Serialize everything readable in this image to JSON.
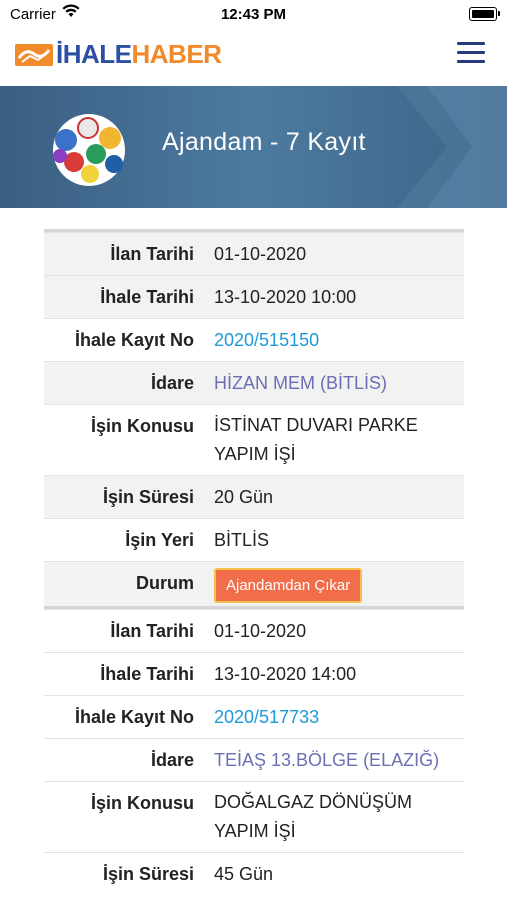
{
  "status": {
    "carrier": "Carrier",
    "time": "12:43 PM"
  },
  "brand": {
    "part1": "İHALE",
    "part2": "HABER"
  },
  "banner": {
    "title": "Ajandam - 7 Kayıt"
  },
  "labels": {
    "ilan_tarihi": "İlan Tarihi",
    "ihale_tarihi": "İhale Tarihi",
    "kayit_no": "İhale Kayıt No",
    "idare": "İdare",
    "isin_konusu": "İşin Konusu",
    "isin_suresi": "İşin Süresi",
    "isin_yeri": "İşin Yeri",
    "durum": "Durum"
  },
  "records": [
    {
      "ilan_tarihi": "01-10-2020",
      "ihale_tarihi": "13-10-2020 10:00",
      "kayit_no": "2020/515150",
      "idare": "HİZAN MEM (BİTLİS)",
      "isin_konusu_line1": "İSTİNAT DUVARI PARKE",
      "isin_konusu_line2": "YAPIM İŞİ",
      "isin_suresi": "20 Gün",
      "isin_yeri": "BİTLİS",
      "durum_button": "Ajandamdan Çıkar"
    },
    {
      "ilan_tarihi": "01-10-2020",
      "ihale_tarihi": "13-10-2020 14:00",
      "kayit_no": "2020/517733",
      "idare": "TEİAŞ 13.BÖLGE (ELAZIĞ)",
      "isin_konusu_line1": "DOĞALGAZ DÖNÜŞÜM",
      "isin_konusu_line2": "YAPIM İŞİ",
      "isin_suresi": "45 Gün"
    }
  ],
  "colors": {
    "accent_orange": "#f26d4a",
    "link_blue": "#1c9ad6",
    "idare_purple": "#6b6fb3",
    "banner_blue": "#4d7aa0"
  }
}
